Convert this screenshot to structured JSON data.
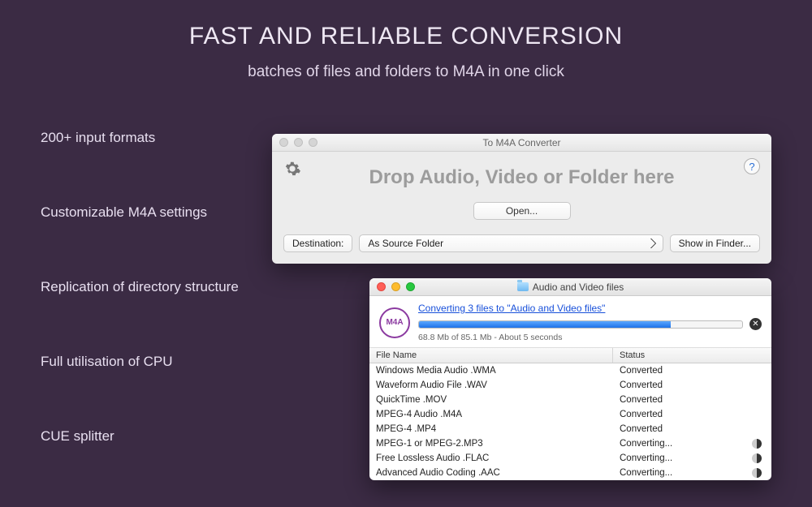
{
  "hero": {
    "title": "FAST AND RELIABLE CONVERSION",
    "subtitle": "batches of files and folders to M4A in one click"
  },
  "features": [
    "200+ input formats",
    "Customizable M4A settings",
    "Replication of directory structure",
    "Full utilisation of CPU",
    "CUE splitter"
  ],
  "win1": {
    "title": "To M4A Converter",
    "drop_text": "Drop Audio, Video or Folder here",
    "open_label": "Open...",
    "destination_label": "Destination:",
    "destination_value": "As Source Folder",
    "show_in_finder": "Show in Finder...",
    "help_label": "?"
  },
  "win2": {
    "title": "Audio and Video files",
    "badge": "M4A",
    "link_text": "Converting 3 files to \"Audio and Video files\"",
    "progress_text": "68.8 Mb of 85.1 Mb - About 5 seconds",
    "progress_percent": 78,
    "columns": {
      "name": "File Name",
      "status": "Status"
    },
    "rows": [
      {
        "name": "Windows Media Audio .WMA",
        "status": "Converted",
        "busy": false
      },
      {
        "name": "Waveform Audio File .WAV",
        "status": "Converted",
        "busy": false
      },
      {
        "name": "QuickTime .MOV",
        "status": "Converted",
        "busy": false
      },
      {
        "name": "MPEG-4 Audio .M4A",
        "status": "Converted",
        "busy": false
      },
      {
        "name": "MPEG-4 .MP4",
        "status": "Converted",
        "busy": false
      },
      {
        "name": "MPEG-1 or MPEG-2.MP3",
        "status": "Converting...",
        "busy": true
      },
      {
        "name": "Free Lossless Audio .FLAC",
        "status": "Converting...",
        "busy": true
      },
      {
        "name": "Advanced Audio Coding .AAC",
        "status": "Converting...",
        "busy": true
      }
    ]
  }
}
